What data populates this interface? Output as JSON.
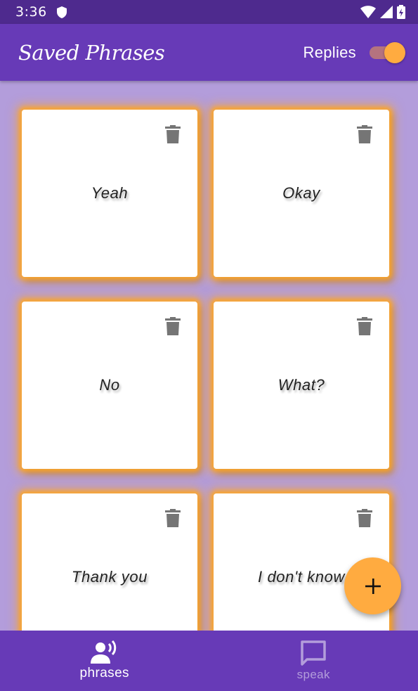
{
  "status_bar": {
    "time": "3:36"
  },
  "app_bar": {
    "title": "Saved Phrases",
    "replies_label": "Replies",
    "replies_on": true
  },
  "phrases": [
    {
      "text": "Yeah"
    },
    {
      "text": "Okay"
    },
    {
      "text": "No"
    },
    {
      "text": "What?"
    },
    {
      "text": "Thank you"
    },
    {
      "text": "I don't know"
    }
  ],
  "bottom_nav": [
    {
      "label": "phrases",
      "icon": "record-voice-icon",
      "active": true
    },
    {
      "label": "speak",
      "icon": "chat-bubble-icon",
      "active": false
    }
  ],
  "colors": {
    "primary": "#673ab7",
    "primary_dark": "#4e2a8e",
    "accent": "#ffab40",
    "background": "#b39ddb"
  }
}
